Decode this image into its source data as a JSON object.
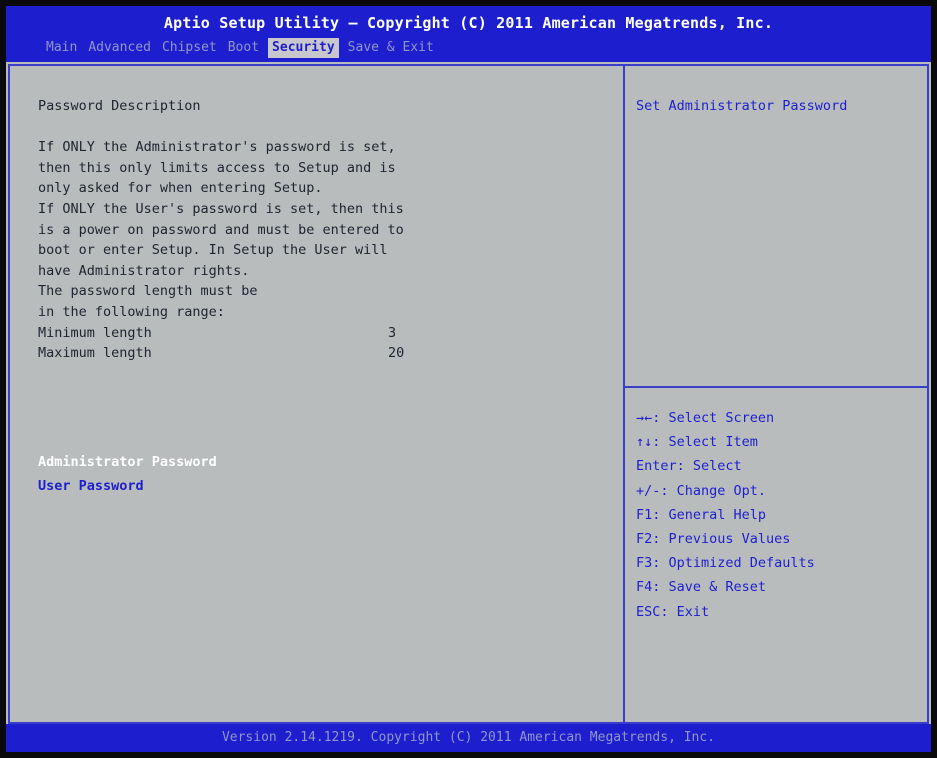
{
  "header": {
    "title": "Aptio Setup Utility – Copyright (C) 2011 American Megatrends, Inc.",
    "tabs": [
      "Main",
      "Advanced",
      "Chipset",
      "Boot",
      "Security",
      "Save & Exit"
    ],
    "active_tab": "Security"
  },
  "main": {
    "section_title": "Password Description",
    "description_lines": [
      "If ONLY the Administrator's password is set,",
      "then this only limits access to Setup and is",
      "only asked for when entering Setup.",
      "If ONLY the User's password is set, then this",
      "is a power on password and must be entered to",
      "boot or enter Setup. In Setup the User will",
      "have Administrator rights.",
      "The password length must be",
      "in the following range:"
    ],
    "min_length": {
      "label": "Minimum length",
      "value": "3"
    },
    "max_length": {
      "label": "Maximum length",
      "value": "20"
    },
    "items": [
      {
        "label": "Administrator Password",
        "selected": true
      },
      {
        "label": "User Password",
        "selected": false
      }
    ]
  },
  "help": {
    "text": "Set Administrator Password"
  },
  "keys": [
    "→←: Select Screen",
    "↑↓: Select Item",
    "Enter: Select",
    "+/-: Change Opt.",
    "F1: General Help",
    "F2: Previous Values",
    "F3: Optimized Defaults",
    "F4: Save & Reset",
    "ESC: Exit"
  ],
  "footer": {
    "version": "Version 2.14.1219. Copyright (C) 2011 American Megatrends, Inc."
  },
  "colors": {
    "header_bg": "#1d1fcf",
    "panel_bg": "#b9bcbd",
    "highlight_text": "#1d1fcf",
    "selected_text": "#ffffff"
  }
}
